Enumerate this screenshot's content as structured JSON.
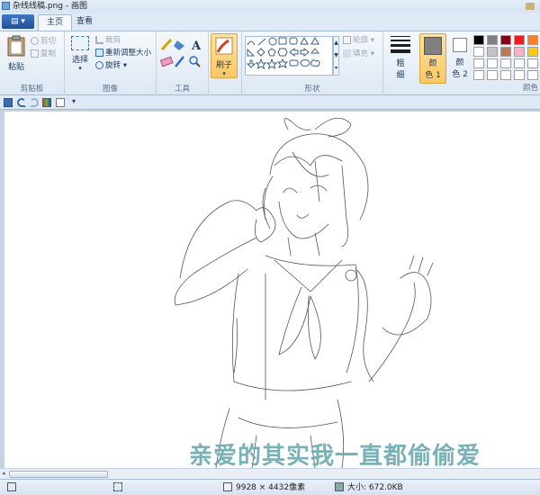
{
  "window": {
    "title": "杂线线稿.png - 画图"
  },
  "tabs": {
    "file_label": "▤ ▾",
    "home": "主页",
    "view": "查看"
  },
  "clipboard": {
    "paste": "粘贴",
    "cut": "剪切",
    "copy": "复制",
    "group": "剪贴板"
  },
  "image": {
    "select": "选择",
    "crop": "裁剪",
    "resize": "重新调整大小",
    "rotate": "旋转",
    "group": "图像"
  },
  "tools": {
    "group": "工具"
  },
  "brush": {
    "label": "刷子"
  },
  "shapes": {
    "outline": "轮廓",
    "fill": "填充",
    "group": "形状"
  },
  "size": {
    "label1": "粗",
    "label2": "细"
  },
  "colors": {
    "color1_label1": "颜",
    "color1_label2": "色 1",
    "color2_label1": "颜",
    "color2_label2": "色 2",
    "group": "颜色",
    "color1": "#808080",
    "color2": "#ffffff",
    "palette": [
      "#000000",
      "#7f7f7f",
      "#880015",
      "#ed1c24",
      "#ff7f27",
      "#ffffff",
      "#c3c3c3",
      "#b97a57",
      "#ffaec9",
      "#ffc90e",
      "#ffffff",
      "#ffffff",
      "#ffffff",
      "#ffffff",
      "#ffffff",
      "#ffffff",
      "#ffffff",
      "#ffffff",
      "#ffffff",
      "#ffffff"
    ]
  },
  "canvas": {
    "watermark": "亲爱的其实我一直都偷偷爱"
  },
  "status": {
    "dimensions": "9928 × 4432像素",
    "size": "大小: 672.0KB"
  }
}
